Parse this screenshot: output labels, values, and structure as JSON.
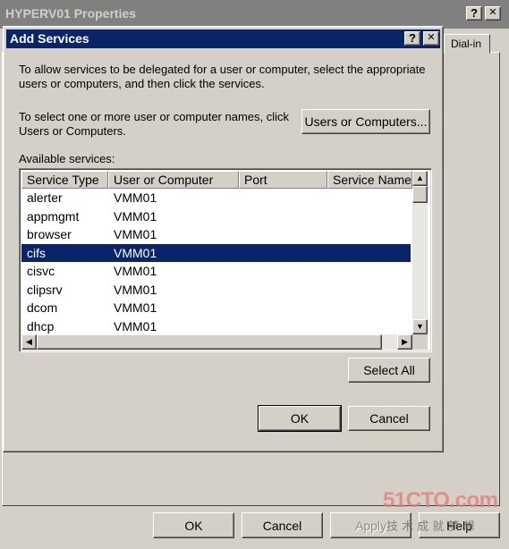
{
  "outer": {
    "title": "HYPERV01 Properties",
    "help_glyph": "?",
    "close_glyph": "✕",
    "tab_label": "Dial-in",
    "ok_label": "OK",
    "cancel_label": "Cancel",
    "apply_label": "Apply",
    "help_label": "Help"
  },
  "dialog": {
    "title": "Add Services",
    "help_glyph": "?",
    "close_glyph": "✕",
    "intro_line1": "To allow services to be delegated for a user or computer, select the appropriate",
    "intro_line2": "users or computers, and then click the services.",
    "select_line1": "To select one or more user or computer names, click",
    "select_line2": "Users or Computers.",
    "users_button": "Users or Computers...",
    "available_label": "Available services:",
    "select_all": "Select All",
    "ok": "OK",
    "cancel": "Cancel"
  },
  "table": {
    "columns": [
      "Service Type",
      "User or Computer",
      "Port",
      "Service Name"
    ],
    "rows": [
      {
        "service": "alerter",
        "user": "VMM01"
      },
      {
        "service": "appmgmt",
        "user": "VMM01"
      },
      {
        "service": "browser",
        "user": "VMM01"
      },
      {
        "service": "cifs",
        "user": "VMM01"
      },
      {
        "service": "cisvc",
        "user": "VMM01"
      },
      {
        "service": "clipsrv",
        "user": "VMM01"
      },
      {
        "service": "dcom",
        "user": "VMM01"
      },
      {
        "service": "dhcp",
        "user": "VMM01"
      }
    ],
    "selected_index": 3
  },
  "scroll_glyphs": {
    "up": "▲",
    "down": "▼",
    "left": "◀",
    "right": "▶"
  },
  "watermark": {
    "brand": "51CTO.com",
    "tagline": "技 术 成 就 梦 想"
  }
}
